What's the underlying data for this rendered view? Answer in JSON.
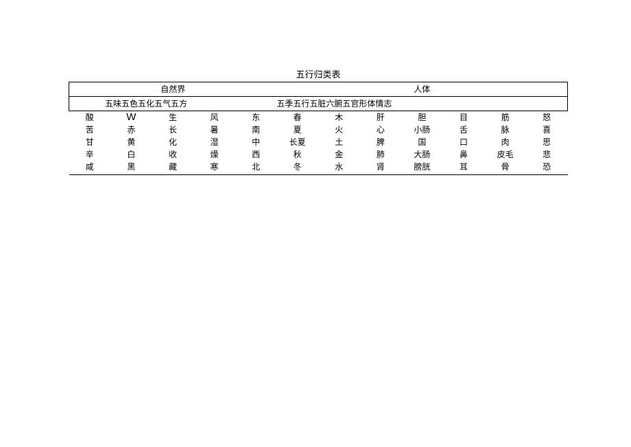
{
  "title": "五行归类表",
  "group_headers": {
    "nature": "自然界",
    "body": "人体"
  },
  "sub_headers": {
    "nature": "五味五色五化五气五方",
    "body": "五季五行五脏六腑五官形体情志"
  },
  "rows": [
    [
      "酸",
      "W",
      "生",
      "风",
      "东",
      "春",
      "木",
      "肝",
      "胆",
      "目",
      "筋",
      "怒"
    ],
    [
      "苦",
      "赤",
      "长",
      "暑",
      "南",
      "夏",
      "火",
      "心",
      "小肠",
      "舌",
      "脉",
      "喜"
    ],
    [
      "甘",
      "黄",
      "化",
      "湿",
      "中",
      "长夏",
      "土",
      "脾",
      "国",
      "口",
      "肉",
      "思"
    ],
    [
      "辛",
      "白",
      "收",
      "燥",
      "西",
      "秋",
      "金",
      "肺",
      "大肠",
      "鼻",
      "皮毛",
      "悲"
    ],
    [
      "咸",
      "黑",
      "藏",
      "寒",
      "北",
      "冬",
      "水",
      "肾",
      "膀胱",
      "耳",
      "骨",
      "恐"
    ]
  ]
}
